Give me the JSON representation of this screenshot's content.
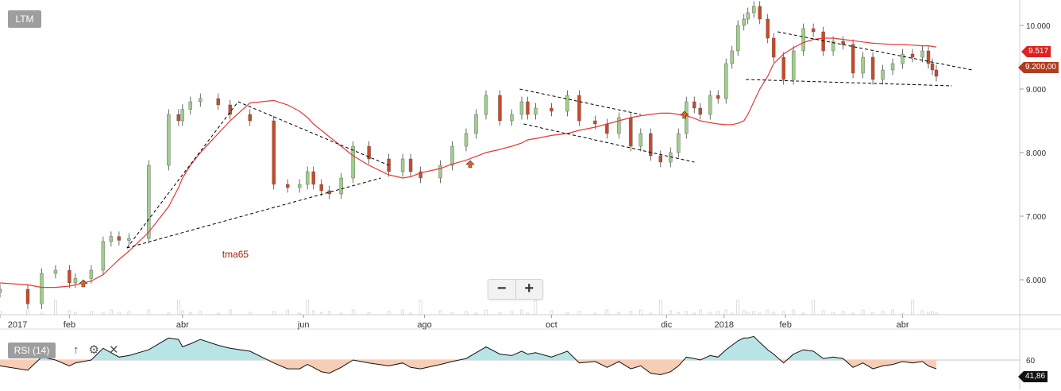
{
  "ticker": "LTM",
  "colors": {
    "up": "#9fcf8a",
    "down": "#c84a2a",
    "ma": "#e53935",
    "trend": "#000000",
    "rsi_up_fill": "#b8e4e6",
    "rsi_down_fill": "#f8cdb5",
    "grid": "#c8c8c8"
  },
  "price_ticks": [
    "10.000",
    "9.000",
    "8.000",
    "7.000",
    "6.000"
  ],
  "price_tick_values": [
    10,
    9,
    8,
    7,
    6
  ],
  "price_range": [
    5.45,
    10.4
  ],
  "x_labels": [
    "2017",
    "feb",
    "abr",
    "jun",
    "ago",
    "oct",
    "dic",
    "2018",
    "feb",
    "abr"
  ],
  "x_label_days": [
    0,
    35,
    92,
    153,
    214,
    278,
    336,
    365,
    396,
    455
  ],
  "x_range_days": [
    0,
    474
  ],
  "last_price_label": "9.517",
  "ref_price_label": "9.200,00",
  "ma_label": "tma65",
  "zoom": {
    "minus": "−",
    "plus": "+"
  },
  "rsi": {
    "label": "RSI (14)",
    "tick": "60",
    "value_label": "41,86",
    "tools": {
      "up": "↑",
      "settings": "⚙",
      "close": "✕"
    }
  },
  "chart_data": {
    "type": "candlestick",
    "title": "LTM",
    "series": [
      {
        "name": "LTM",
        "x_days": [
          0,
          14,
          21,
          28,
          35,
          38,
          46,
          52,
          56,
          60,
          65,
          75,
          85,
          90,
          92,
          96,
          101,
          110,
          116,
          126,
          138,
          145,
          151,
          155,
          158,
          162,
          166,
          172,
          178,
          186,
          196,
          203,
          207,
          212,
          222,
          228,
          235,
          240,
          245,
          252,
          258,
          263,
          266,
          270,
          278,
          286,
          292,
          300,
          306,
          312,
          318,
          323,
          328,
          333,
          338,
          342,
          346,
          350,
          353,
          358,
          362,
          366,
          369,
          372,
          375,
          377,
          380,
          383,
          387,
          390,
          395,
          400,
          405,
          410,
          415,
          420,
          425,
          430,
          435,
          440,
          445,
          450,
          455,
          460,
          465,
          468,
          470,
          472
        ],
        "close": [
          5.85,
          5.62,
          6.1,
          6.15,
          5.95,
          6.02,
          6.15,
          6.6,
          6.68,
          6.62,
          6.65,
          7.8,
          8.6,
          8.5,
          8.68,
          8.8,
          8.85,
          8.75,
          8.6,
          8.5,
          7.5,
          7.45,
          7.5,
          7.7,
          7.5,
          7.4,
          7.35,
          7.6,
          8.1,
          7.9,
          7.7,
          7.9,
          7.7,
          7.6,
          7.8,
          8.1,
          8.3,
          8.6,
          8.9,
          8.5,
          8.6,
          8.8,
          8.6,
          8.7,
          8.65,
          8.9,
          8.5,
          8.45,
          8.3,
          8.55,
          8.1,
          8.3,
          7.95,
          7.85,
          8.0,
          8.3,
          8.8,
          8.7,
          8.6,
          8.9,
          8.85,
          9.4,
          9.6,
          10.0,
          10.1,
          10.2,
          10.3,
          10.1,
          9.8,
          9.5,
          9.15,
          9.6,
          9.95,
          9.9,
          9.6,
          9.75,
          9.7,
          9.25,
          9.5,
          9.15,
          9.3,
          9.4,
          9.55,
          9.5,
          9.6,
          9.4,
          9.3,
          9.2
        ],
        "ma65": [
          5.95,
          5.92,
          5.88,
          5.88,
          5.9,
          5.92,
          5.98,
          6.08,
          6.2,
          6.32,
          6.45,
          6.75,
          7.15,
          7.45,
          7.6,
          7.8,
          8.0,
          8.3,
          8.5,
          8.78,
          8.82,
          8.75,
          8.65,
          8.55,
          8.45,
          8.35,
          8.25,
          8.1,
          7.95,
          7.8,
          7.65,
          7.6,
          7.62,
          7.68,
          7.75,
          7.82,
          7.88,
          7.94,
          8.0,
          8.05,
          8.1,
          8.15,
          8.2,
          8.22,
          8.27,
          8.3,
          8.35,
          8.4,
          8.45,
          8.5,
          8.55,
          8.58,
          8.6,
          8.62,
          8.62,
          8.6,
          8.58,
          8.54,
          8.5,
          8.47,
          8.45,
          8.44,
          8.44,
          8.46,
          8.5,
          8.6,
          8.8,
          9.0,
          9.2,
          9.4,
          9.55,
          9.65,
          9.73,
          9.78,
          9.8,
          9.8,
          9.78,
          9.76,
          9.74,
          9.72,
          9.71,
          9.7,
          9.7,
          9.69,
          9.68,
          9.68,
          9.67,
          9.66
        ]
      }
    ],
    "trendlines": [
      {
        "x": [
          64,
          120
        ],
        "y": [
          6.5,
          8.8
        ]
      },
      {
        "x": [
          64,
          192
        ],
        "y": [
          6.5,
          7.6
        ]
      },
      {
        "x": [
          120,
          196
        ],
        "y": [
          8.8,
          7.8
        ]
      },
      {
        "x": [
          262,
          323
        ],
        "y": [
          9.0,
          8.6
        ]
      },
      {
        "x": [
          264,
          350
        ],
        "y": [
          8.45,
          7.85
        ]
      },
      {
        "x": [
          392,
          490
        ],
        "y": [
          9.9,
          9.3
        ]
      },
      {
        "x": [
          376,
          480
        ],
        "y": [
          9.15,
          9.05
        ]
      }
    ],
    "signal_arrows_days": [
      42,
      237,
      345
    ],
    "volume_bars": [
      0.2,
      0.3,
      0.1,
      0.9,
      0.25,
      0.15,
      0.2,
      0.1,
      0.3,
      0.15
    ],
    "rsi_series": [
      56,
      53,
      62,
      60,
      56,
      58,
      60,
      68,
      65,
      62,
      63,
      67,
      75,
      74,
      69,
      71,
      74,
      70,
      68,
      66,
      58,
      54,
      54,
      57,
      55,
      52,
      51,
      55,
      60,
      58,
      56,
      58,
      55,
      54,
      57,
      59,
      61,
      65,
      69,
      64,
      63,
      66,
      64,
      65,
      62,
      66,
      58,
      59,
      55,
      59,
      54,
      56,
      51,
      50,
      52,
      56,
      62,
      61,
      60,
      63,
      62,
      67,
      70,
      73,
      75,
      75,
      76,
      72,
      67,
      64,
      58,
      64,
      67,
      66,
      61,
      62,
      61,
      55,
      58,
      54,
      56,
      57,
      59,
      58,
      59,
      56,
      55,
      54
    ],
    "rsi_range": [
      40,
      80
    ],
    "rsi_level": 60,
    "ylim": [
      5.45,
      10.4
    ]
  }
}
